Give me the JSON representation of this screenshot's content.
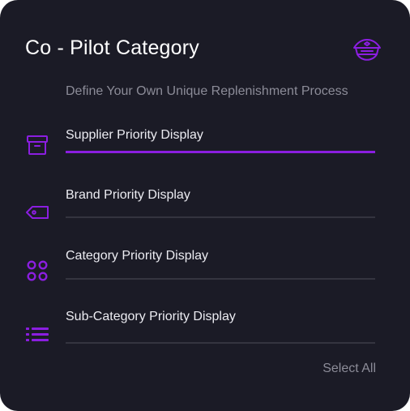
{
  "colors": {
    "background": "#1b1b26",
    "accent": "#8b1ee0",
    "title_text": "#ffffff",
    "muted_text": "#8c8c98",
    "divider": "#34343f"
  },
  "header": {
    "title": "Co - Pilot Category",
    "icon": "pilot-cap-icon"
  },
  "subtitle": "Define Your Own Unique Replenishment Process",
  "options": [
    {
      "label": "Supplier Priority Display",
      "icon": "box-icon",
      "selected": true
    },
    {
      "label": "Brand Priority Display",
      "icon": "tag-icon",
      "selected": false
    },
    {
      "label": "Category Priority Display",
      "icon": "grid-circles-icon",
      "selected": false
    },
    {
      "label": "Sub-Category Priority Display",
      "icon": "list-icon",
      "selected": false
    }
  ],
  "select_all_label": "Select All"
}
